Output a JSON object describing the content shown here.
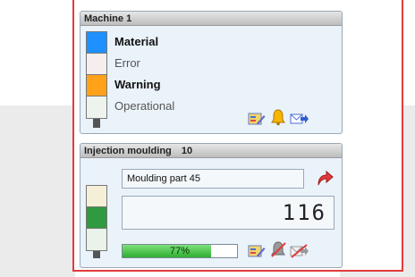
{
  "machine_panel": {
    "title": "Machine 1",
    "statuses": [
      {
        "label": "Material",
        "color": "#1e90ff",
        "bold": true
      },
      {
        "label": "Error",
        "color": "#f6eeee",
        "bold": false
      },
      {
        "label": "Warning",
        "color": "#ffa21a",
        "bold": true
      },
      {
        "label": "Operational",
        "color": "#eef3ee",
        "bold": false
      }
    ],
    "icons": [
      "edit-icon",
      "bell-icon",
      "forward-mail-icon"
    ]
  },
  "moulding_panel": {
    "title": "Injection moulding",
    "number": "10",
    "part_name": "Moulding part 45",
    "counter": "116",
    "progress_percent": 77,
    "progress_label": "77%",
    "lamp_colors": [
      "#f5efd8",
      "#2f9a3f",
      "#e9f3e9"
    ],
    "icons": [
      "redo-arrow-icon",
      "edit-icon",
      "bell-muted-icon",
      "forward-mail-disabled-icon"
    ]
  }
}
